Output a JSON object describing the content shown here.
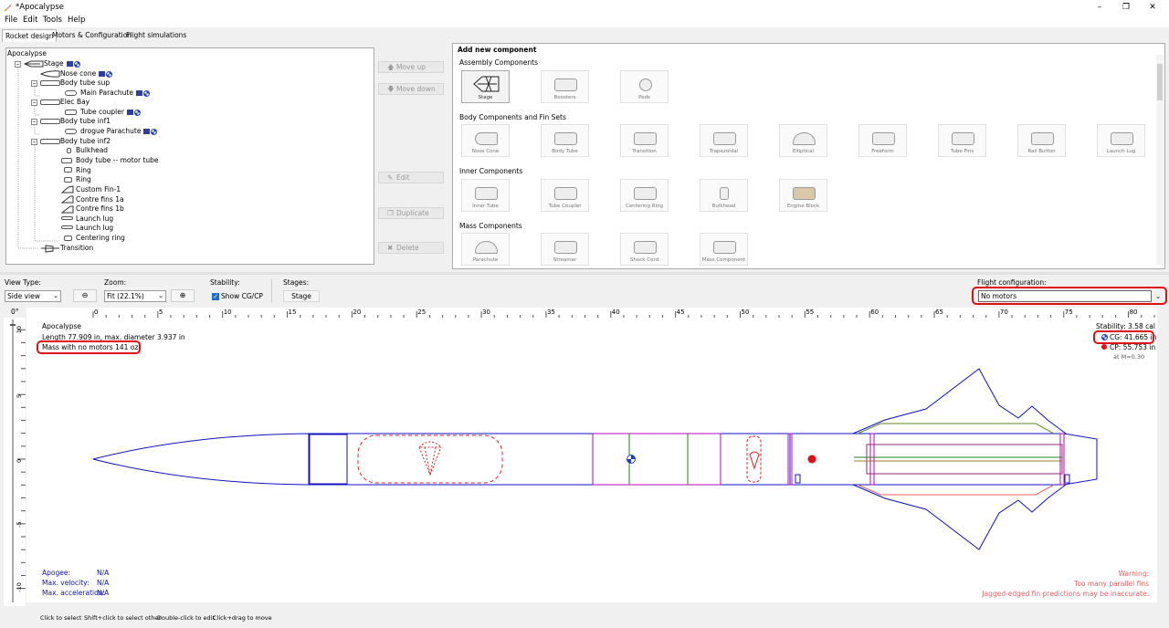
{
  "window": {
    "title": "*Apocalypse"
  },
  "menu": [
    "File",
    "Edit",
    "Tools",
    "Help"
  ],
  "tabs": [
    "Rocket design",
    "Motors & Configuration",
    "Flight simulations"
  ],
  "tree": {
    "root": "Apocalypse",
    "items": [
      {
        "label": "Stage"
      },
      {
        "label": "Nose cone"
      },
      {
        "label": "Body tube sup"
      },
      {
        "label": "Main Parachute"
      },
      {
        "label": "Elec Bay"
      },
      {
        "label": "Tube coupler"
      },
      {
        "label": "Body tube inf1"
      },
      {
        "label": "drogue Parachute"
      },
      {
        "label": "Body tube inf2"
      },
      {
        "label": "Bulkhead"
      },
      {
        "label": "Body tube -- motor tube"
      },
      {
        "label": "Ring"
      },
      {
        "label": "Ring"
      },
      {
        "label": "Custom Fin-1"
      },
      {
        "label": "Contre fins 1a"
      },
      {
        "label": "Contre fins 1b"
      },
      {
        "label": "Launch lug"
      },
      {
        "label": "Launch lug"
      },
      {
        "label": "Centering ring"
      },
      {
        "label": "Transition"
      }
    ]
  },
  "side_buttons": {
    "move_up": "Move up",
    "move_down": "Move down",
    "edit": "Edit",
    "duplicate": "Duplicate",
    "delete": "Delete"
  },
  "add_component": {
    "header": "Add new component",
    "sections": [
      {
        "title": "Assembly Components",
        "items": [
          "Stage",
          "Boosters",
          "Pods"
        ]
      },
      {
        "title": "Body Components and Fin Sets",
        "items": [
          "Nose Cone",
          "Body Tube",
          "Transition",
          "Trapezoidal",
          "Elliptical",
          "Freeform",
          "Tube Fins",
          "Rail Button",
          "Launch Lug"
        ]
      },
      {
        "title": "Inner Components",
        "items": [
          "Inner Tube",
          "Tube Coupler",
          "Centering Ring",
          "Bulkhead",
          "Engine Block"
        ]
      },
      {
        "title": "Mass Components",
        "items": [
          "Parachute",
          "Streamer",
          "Shock Cord",
          "Mass Component"
        ]
      }
    ]
  },
  "view": {
    "view_type_label": "View Type:",
    "view_type_value": "Side view",
    "zoom_label": "Zoom:",
    "zoom_value": "Fit (22.1%)",
    "stability_label": "Stability:",
    "show_cgcp": "Show CG/CP",
    "stages_label": "Stages:",
    "stage_button": "Stage",
    "flight_config_label": "Flight configuration:",
    "flight_config_value": "No motors",
    "angle": "0°"
  },
  "ruler": {
    "h_ticks": [
      "0",
      "5",
      "10",
      "15",
      "20",
      "25",
      "30",
      "35",
      "40",
      "45",
      "50",
      "55",
      "60",
      "65",
      "70",
      "75",
      "80"
    ],
    "v_ticks": [
      "10",
      "5",
      "0",
      "-5",
      "-10"
    ]
  },
  "info": {
    "name": "Apocalypse",
    "length": "Length 77.909 in, max. diameter 3.937 in",
    "mass": "Mass with no motors 141 oz",
    "stability": "Stability:  3.58 cal",
    "cg": "CG: 41.665 in",
    "cp": "CP: 55.753 in",
    "mach": "at M=0.30"
  },
  "results": [
    {
      "label": "Apogee:",
      "value": "N/A"
    },
    {
      "label": "Max. velocity:",
      "value": "N/A"
    },
    {
      "label": "Max. acceleration:",
      "value": "N/A"
    }
  ],
  "warning": {
    "title": "Warning:",
    "lines": [
      "Too many parallel fins",
      "Jagged-edged fin predictions may be inaccurate."
    ]
  },
  "status": [
    "Click to select",
    "Shift+click to select other",
    "Double-click to edit",
    "Click+drag to move"
  ],
  "colors": {
    "accent": "#1a6fd6",
    "rocket_outline": "#1010c0",
    "highlight": "#e01010",
    "warning": "#f06060"
  }
}
